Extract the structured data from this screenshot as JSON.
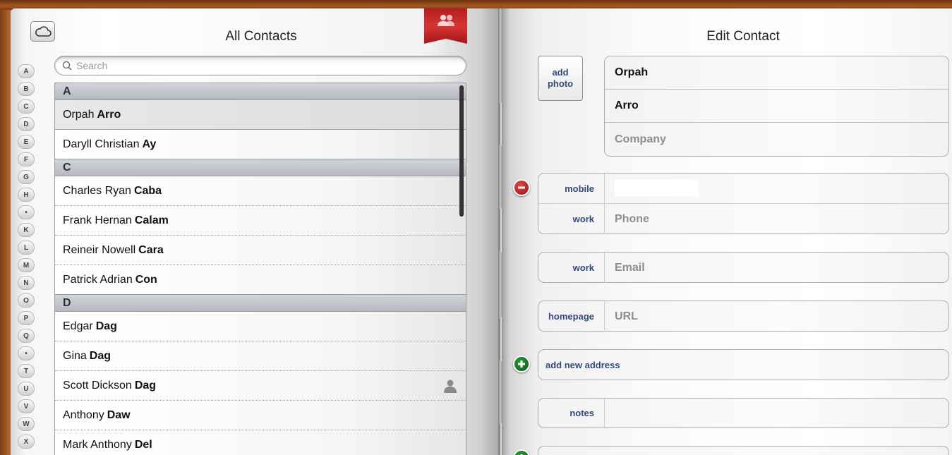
{
  "left_page": {
    "title": "All Contacts",
    "search_placeholder": "Search"
  },
  "index_letters": [
    "A",
    "B",
    "C",
    "D",
    "E",
    "F",
    "G",
    "H",
    "•",
    "K",
    "L",
    "M",
    "N",
    "O",
    "P",
    "Q",
    "•",
    "T",
    "U",
    "V",
    "W",
    "X"
  ],
  "contacts": {
    "sections": [
      {
        "letter": "A",
        "rows": [
          {
            "first": "Orpah",
            "last": "Arro",
            "selected": true
          },
          {
            "first": "Daryll Christian",
            "last": "Ay"
          }
        ]
      },
      {
        "letter": "C",
        "rows": [
          {
            "first": "Charles Ryan",
            "last": "Caba"
          },
          {
            "first": "Frank Hernan",
            "last": "Calam"
          },
          {
            "first": "Reineir Nowell",
            "last": "Cara"
          },
          {
            "first": "Patrick Adrian",
            "last": "Con"
          }
        ]
      },
      {
        "letter": "D",
        "rows": [
          {
            "first": "Edgar",
            "last": "Dag"
          },
          {
            "first": "Gina",
            "last": "Dag"
          },
          {
            "first": "Scott Dickson",
            "last": "Dag",
            "icon": "person-icon"
          },
          {
            "first": "Anthony",
            "last": "Daw"
          },
          {
            "first": "Mark Anthony",
            "last": "Del"
          }
        ]
      }
    ]
  },
  "right_page": {
    "title": "Edit Contact",
    "add_photo": "add\nphoto",
    "first_name": "Orpah",
    "last_name": "Arro",
    "company_placeholder": "Company",
    "phones": [
      {
        "label": "mobile",
        "value": ""
      },
      {
        "label": "work",
        "placeholder": "Phone"
      }
    ],
    "email": {
      "label": "work",
      "placeholder": "Email"
    },
    "url": {
      "label": "homepage",
      "placeholder": "URL"
    },
    "add_address": "add new address",
    "notes": {
      "label": "notes",
      "value": ""
    }
  },
  "colors": {
    "label_blue": "#344a7a",
    "bookmark_red": "#c42828",
    "delete_red": "#b01c1c",
    "add_green": "#187a25"
  }
}
